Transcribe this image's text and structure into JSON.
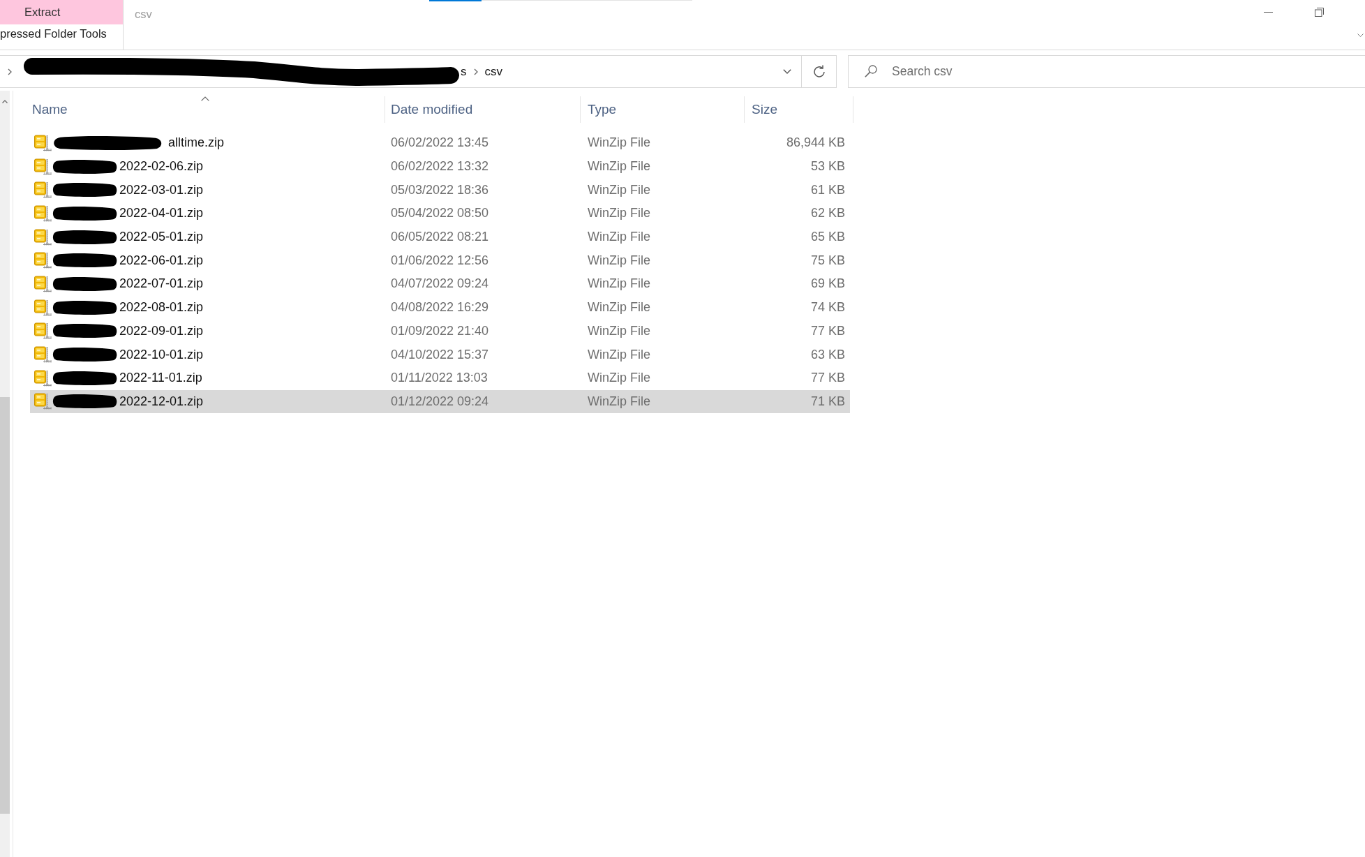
{
  "ribbon": {
    "contextual_tab": "Extract",
    "tool_group": "pressed Folder Tools"
  },
  "window": {
    "title": "csv"
  },
  "address_bar": {
    "segments": [
      {
        "label": "s",
        "redacted": true
      },
      {
        "label": "csv",
        "redacted": false
      }
    ]
  },
  "search": {
    "placeholder": "Search csv"
  },
  "file_list": {
    "columns": [
      {
        "label": "Name",
        "sorted": true
      },
      {
        "label": "Date modified",
        "sorted": false
      },
      {
        "label": "Type",
        "sorted": false
      },
      {
        "label": "Size",
        "sorted": false
      }
    ],
    "rows": [
      {
        "name": "alltime.zip",
        "name_redacted": true,
        "date_modified": "06/02/2022 13:45",
        "type": "WinZip File",
        "size": "86,944 KB",
        "selected": false
      },
      {
        "name": "2022-02-06.zip",
        "name_redacted": true,
        "date_modified": "06/02/2022 13:32",
        "type": "WinZip File",
        "size": "53 KB",
        "selected": false
      },
      {
        "name": "2022-03-01.zip",
        "name_redacted": true,
        "date_modified": "05/03/2022 18:36",
        "type": "WinZip File",
        "size": "61 KB",
        "selected": false
      },
      {
        "name": "2022-04-01.zip",
        "name_redacted": true,
        "date_modified": "05/04/2022 08:50",
        "type": "WinZip File",
        "size": "62 KB",
        "selected": false
      },
      {
        "name": "2022-05-01.zip",
        "name_redacted": true,
        "date_modified": "06/05/2022 08:21",
        "type": "WinZip File",
        "size": "65 KB",
        "selected": false
      },
      {
        "name": "2022-06-01.zip",
        "name_redacted": true,
        "date_modified": "01/06/2022 12:56",
        "type": "WinZip File",
        "size": "75 KB",
        "selected": false
      },
      {
        "name": "2022-07-01.zip",
        "name_redacted": true,
        "date_modified": "04/07/2022 09:24",
        "type": "WinZip File",
        "size": "69 KB",
        "selected": false
      },
      {
        "name": "2022-08-01.zip",
        "name_redacted": true,
        "date_modified": "04/08/2022 16:29",
        "type": "WinZip File",
        "size": "74 KB",
        "selected": false
      },
      {
        "name": "2022-09-01.zip",
        "name_redacted": true,
        "date_modified": "01/09/2022 21:40",
        "type": "WinZip File",
        "size": "77 KB",
        "selected": false
      },
      {
        "name": "2022-10-01.zip",
        "name_redacted": true,
        "date_modified": "04/10/2022 15:37",
        "type": "WinZip File",
        "size": "63 KB",
        "selected": false
      },
      {
        "name": "2022-11-01.zip",
        "name_redacted": true,
        "date_modified": "01/11/2022 13:03",
        "type": "WinZip File",
        "size": "77 KB",
        "selected": false
      },
      {
        "name": "2022-12-01.zip",
        "name_redacted": true,
        "date_modified": "01/12/2022 09:24",
        "type": "WinZip File",
        "size": "71 KB",
        "selected": true
      }
    ]
  }
}
